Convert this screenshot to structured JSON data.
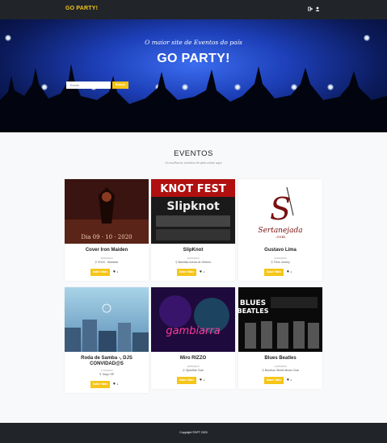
{
  "navbar": {
    "brand": "GO PARTY!",
    "icons": [
      "login-icon",
      "user-icon"
    ]
  },
  "hero": {
    "subtitle": "O maior site de Eventos do país",
    "title": "GO PARTY!",
    "search_placeholder": "Evento",
    "search_button": "Buscar"
  },
  "events_section": {
    "title": "EVENTOS",
    "subtitle": "Os melhores eventos do país estão aqui"
  },
  "events": [
    {
      "name": "Cover Iron Maiden",
      "date": "29/09/2020",
      "location": "VIXIII - Salvador",
      "button": "Saber Mais",
      "likes": "1"
    },
    {
      "name": "SlipKnot",
      "date": "22/09/2020",
      "location": "Bandalo Arena do Grêmio",
      "button": "Saber Mais",
      "likes": "1"
    },
    {
      "name": "Gustavo Lima",
      "date": "22/09/2020",
      "location": "Freio Jockey",
      "button": "Saber Mais",
      "likes": "1"
    },
    {
      "name": "Roda de Samba -, DJS CONVIDAD@S",
      "date": "17/10/2020",
      "location": "Tokyo SP",
      "button": "Saber Mais",
      "likes": "1"
    },
    {
      "name": "Miro RIZZO",
      "date": "18/09/2020",
      "location": "OpenBar Club",
      "button": "Saber Mais",
      "likes": "1"
    },
    {
      "name": "Blues Beatles",
      "date": "12/09/2020",
      "location": "Bourbon Street Music Club",
      "button": "Saber Mais",
      "likes": "1"
    }
  ],
  "footer": {
    "copyright": "Copyright ©GPT 2020"
  },
  "colors": {
    "accent": "#f5c518",
    "dark": "#212529",
    "hero_blue": "#1d3fb8"
  }
}
